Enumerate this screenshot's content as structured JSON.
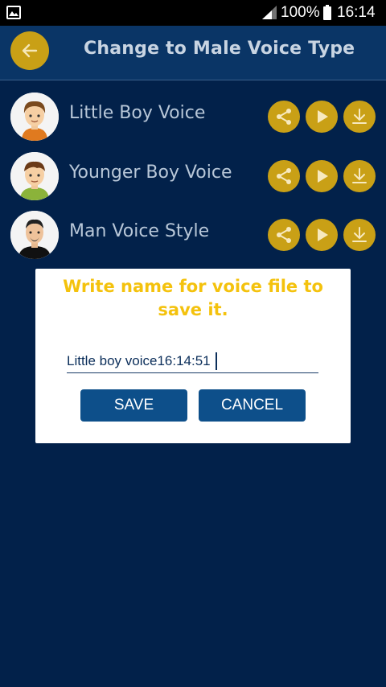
{
  "status_bar": {
    "battery_percent": "100%",
    "time": "16:14"
  },
  "app_bar": {
    "title": "Change to Male Voice Type"
  },
  "voices": [
    {
      "label": "Little Boy Voice"
    },
    {
      "label": "Younger Boy Voice"
    },
    {
      "label": "Man Voice Style"
    }
  ],
  "dialog": {
    "title": "Write name for voice file to save it.",
    "input_value": "Little boy voice16:14:51",
    "save_label": "SAVE",
    "cancel_label": "CANCEL"
  },
  "colors": {
    "background": "#02214a",
    "app_bar": "#0a3566",
    "accent_gold": "#c9a016",
    "dialog_title": "#f4c20d",
    "button_blue": "#0d4f8a"
  },
  "icons": {
    "back": "arrow-left-icon",
    "share": "share-icon",
    "play": "play-icon",
    "download": "download-icon"
  }
}
